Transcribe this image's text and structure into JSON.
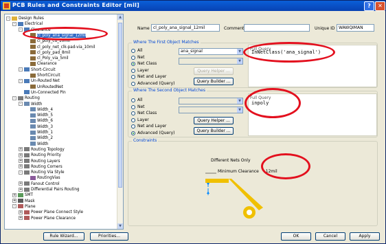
{
  "window": {
    "title": "PCB Rules and Constraints Editor [mil]"
  },
  "tree": {
    "items": [
      {
        "label": "Design Rules",
        "level": 0,
        "exp": "-",
        "icon": "folder-icon"
      },
      {
        "label": "Electrical",
        "level": 1,
        "exp": "-",
        "icon": "rule-icon"
      },
      {
        "label": "Clearance",
        "level": 2,
        "exp": "-",
        "icon": "rule-icon"
      },
      {
        "label": "cl_poly_ana_signal_12mil",
        "level": 3,
        "icon": "clearance-icon",
        "selected": true
      },
      {
        "label": "cl_poly_cu_10mil",
        "level": 3,
        "icon": "clearance-icon"
      },
      {
        "label": "cl_poly_net_clk-pad-via_10mil",
        "level": 3,
        "icon": "clearance-icon"
      },
      {
        "label": "cl_poly_pad_8mil",
        "level": 3,
        "icon": "clearance-icon"
      },
      {
        "label": "cl_Poly_via_5mil",
        "level": 3,
        "icon": "clearance-icon"
      },
      {
        "label": "Clearance",
        "level": 3,
        "icon": "clearance-icon"
      },
      {
        "label": "Short-Circuit",
        "level": 2,
        "exp": "-",
        "icon": "rule-icon"
      },
      {
        "label": "ShortCircuit",
        "level": 3,
        "icon": "clearance-icon"
      },
      {
        "label": "Un-Routed Net",
        "level": 2,
        "exp": "-",
        "icon": "rule-icon"
      },
      {
        "label": "UnRoutedNet",
        "level": 3,
        "icon": "clearance-icon"
      },
      {
        "label": "Un-Connected Pin",
        "level": 2,
        "icon": "rule-icon"
      },
      {
        "label": "Routing",
        "level": 1,
        "exp": "-",
        "icon": "routing-icon"
      },
      {
        "label": "Width",
        "level": 2,
        "exp": "-",
        "icon": "width-icon"
      },
      {
        "label": "Width_4",
        "level": 3,
        "icon": "width-icon"
      },
      {
        "label": "Width_5",
        "level": 3,
        "icon": "width-icon"
      },
      {
        "label": "Width_6",
        "level": 3,
        "icon": "width-icon"
      },
      {
        "label": "Width_3",
        "level": 3,
        "icon": "width-icon"
      },
      {
        "label": "Width_1",
        "level": 3,
        "icon": "width-icon"
      },
      {
        "label": "Width_2",
        "level": 3,
        "icon": "width-icon"
      },
      {
        "label": "Width",
        "level": 3,
        "icon": "width-icon"
      },
      {
        "label": "Routing Topology",
        "level": 2,
        "exp": "+",
        "icon": "routing-icon"
      },
      {
        "label": "Routing Priority",
        "level": 2,
        "exp": "+",
        "icon": "routing-icon"
      },
      {
        "label": "Routing Layers",
        "level": 2,
        "exp": "+",
        "icon": "routing-icon"
      },
      {
        "label": "Routing Corners",
        "level": 2,
        "exp": "+",
        "icon": "routing-icon"
      },
      {
        "label": "Routing Via Style",
        "level": 2,
        "exp": "-",
        "icon": "routing-icon"
      },
      {
        "label": "RoutingVias",
        "level": 3,
        "icon": "via-icon"
      },
      {
        "label": "Fanout Control",
        "level": 2,
        "exp": "+",
        "icon": "routing-icon"
      },
      {
        "label": "Differential Pairs Routing",
        "level": 2,
        "exp": "+",
        "icon": "routing-icon"
      },
      {
        "label": "SMT",
        "level": 1,
        "exp": "+",
        "icon": "smt-icon"
      },
      {
        "label": "Mask",
        "level": 1,
        "exp": "+",
        "icon": "mask-icon"
      },
      {
        "label": "Plane",
        "level": 1,
        "exp": "-",
        "icon": "plane-icon"
      },
      {
        "label": "Power Plane Connect Style",
        "level": 2,
        "exp": "+",
        "icon": "plane-icon"
      },
      {
        "label": "Power Plane Clearance",
        "level": 2,
        "exp": "+",
        "icon": "plane-icon"
      }
    ]
  },
  "rule": {
    "name_label": "Name",
    "name_value": "cl_poly_ana_signal_12mil",
    "comment_label": "Comment",
    "comment_value": "",
    "uid_label": "Unique ID",
    "uid_value": "WAWQIMAN"
  },
  "first_match": {
    "title": "Where The First Object Matches",
    "options": [
      "All",
      "Net",
      "Net Class",
      "Layer",
      "Net and Layer",
      "Advanced (Query)"
    ],
    "selected": "Net Class",
    "net_value": "ana_signal",
    "query_helper": "Query Helper ...",
    "query_builder": "Query Builder ...",
    "query_label": "Full Query",
    "query": "InNetClass('ana_signal')"
  },
  "second_match": {
    "title": "Where The Second Object Matches",
    "options": [
      "All",
      "Net",
      "Net Class",
      "Layer",
      "Net and Layer",
      "Advanced (Query)"
    ],
    "selected": "Advanced (Query)",
    "query_helper": "Query Helper ...",
    "query_builder": "Query Builder ...",
    "query_label": "Full Query",
    "query": "inpoly"
  },
  "constraints": {
    "title": "Constraints",
    "mode_label": "Different Nets Only",
    "min_clearance_label": "Minimum Clearance",
    "min_clearance_value": "12mil"
  },
  "buttons": {
    "rule_wizard": "Rule Wizard...",
    "priorities": "Priorities...",
    "ok": "OK",
    "cancel": "Cancel",
    "apply": "Apply"
  },
  "colors": {
    "annotation": "#e3101e",
    "title_bar": "#0a5fd8",
    "trace": "#f0c000"
  }
}
